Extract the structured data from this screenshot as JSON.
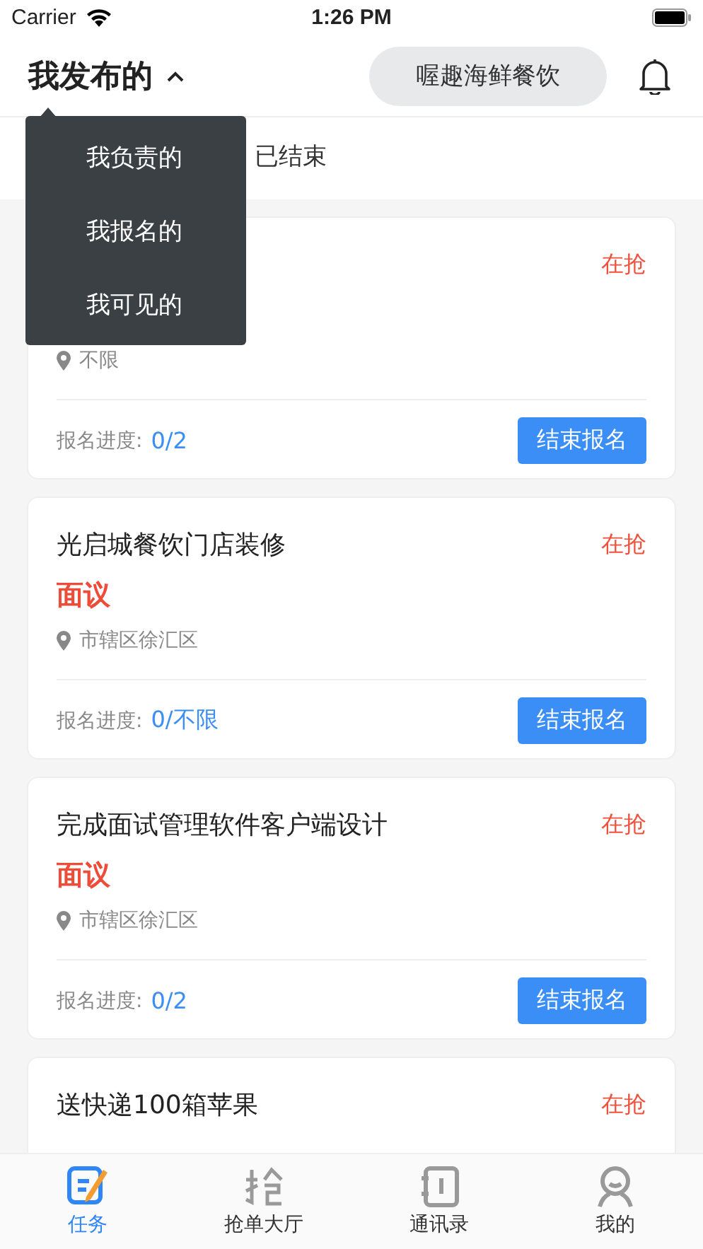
{
  "status_bar": {
    "carrier": "Carrier",
    "time": "1:26 PM"
  },
  "header": {
    "title": "我发布的",
    "expanded": true,
    "company": "喔趣海鲜餐饮"
  },
  "tabs": [
    {
      "label": "已结束",
      "selected": false
    }
  ],
  "dropdown": {
    "items": [
      "我负责的",
      "我报名的",
      "我可见的"
    ]
  },
  "tasks": [
    {
      "status": "在抢",
      "location": "不限",
      "progress_label": "报名进度:",
      "progress": "0/2",
      "button": "结束报名"
    },
    {
      "title": "光启城餐饮门店装修",
      "status": "在抢",
      "price": "面议",
      "location": "市辖区徐汇区",
      "progress_label": "报名进度:",
      "progress": "0/不限",
      "button": "结束报名"
    },
    {
      "title": "完成面试管理软件客户端设计",
      "status": "在抢",
      "price": "面议",
      "location": "市辖区徐汇区",
      "progress_label": "报名进度:",
      "progress": "0/2",
      "button": "结束报名"
    },
    {
      "title": "送快递100箱苹果",
      "status": "在抢"
    }
  ],
  "tab_bar": [
    {
      "label": "任务",
      "kind": "task",
      "selected": true
    },
    {
      "label": "抢单大厅",
      "kind": "grab",
      "selected": false
    },
    {
      "label": "通讯录",
      "kind": "contacts",
      "selected": false
    },
    {
      "label": "我的",
      "kind": "me",
      "selected": false
    }
  ]
}
